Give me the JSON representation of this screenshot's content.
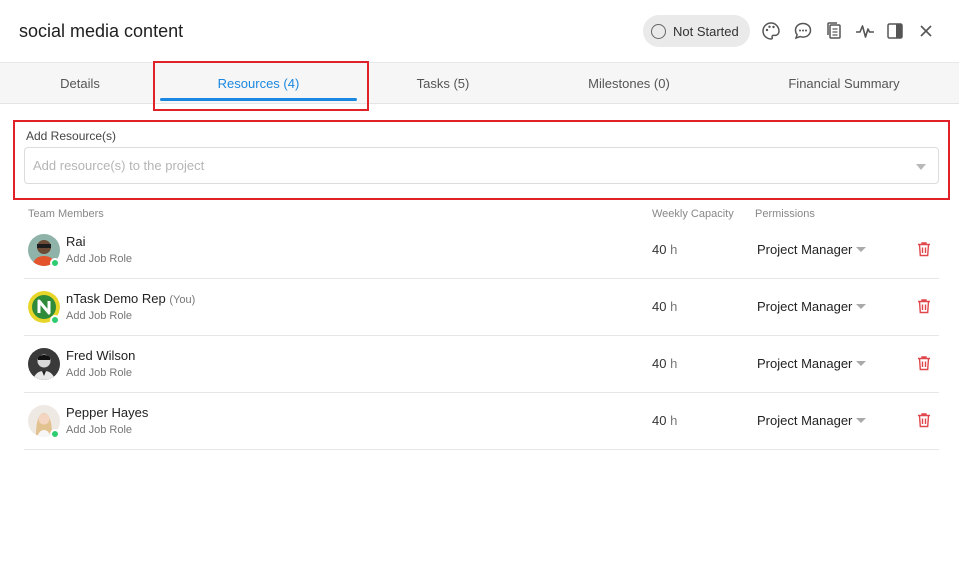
{
  "header": {
    "title": "social media content",
    "status": "Not Started",
    "icons": [
      "palette-icon",
      "comment-icon",
      "copy-icon",
      "activity-icon",
      "panel-icon",
      "close-icon"
    ]
  },
  "tabs": [
    {
      "label": "Details"
    },
    {
      "label": "Resources (4)"
    },
    {
      "label": "Tasks (5)"
    },
    {
      "label": "Milestones (0)"
    },
    {
      "label": "Financial Summary"
    }
  ],
  "add_resource": {
    "label": "Add Resource(s)",
    "placeholder": "Add resource(s) to the project"
  },
  "columns": {
    "members": "Team Members",
    "capacity": "Weekly Capacity",
    "permissions": "Permissions"
  },
  "members": [
    {
      "name": "Rai",
      "you": "",
      "role": "Add Job Role",
      "capacity": "40",
      "unit": "h",
      "permission": "Project Manager"
    },
    {
      "name": "nTask Demo Rep",
      "you": "(You)",
      "role": "Add Job Role",
      "capacity": "40",
      "unit": "h",
      "permission": "Project Manager"
    },
    {
      "name": "Fred Wilson",
      "you": "",
      "role": "Add Job Role",
      "capacity": "40",
      "unit": "h",
      "permission": "Project Manager"
    },
    {
      "name": "Pepper Hayes",
      "you": "",
      "role": "Add Job Role",
      "capacity": "40",
      "unit": "h",
      "permission": "Project Manager"
    }
  ],
  "colors": {
    "accent": "#1a88e0",
    "highlight": "#e02127",
    "online": "#2ecc71",
    "delete": "#e0474c"
  }
}
